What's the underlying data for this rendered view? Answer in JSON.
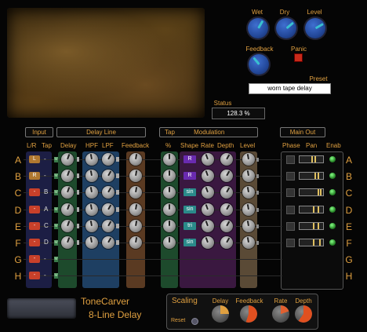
{
  "controls": {
    "wet_label": "Wet",
    "dry_label": "Dry",
    "level_label": "Level",
    "feedback_label": "Feedback",
    "panic_label": "Panic",
    "preset_label": "Preset",
    "preset_value": "worn tape delay",
    "status_label": "Status",
    "status_value": "128.3 %"
  },
  "sections": {
    "input": "Input",
    "delay_line": "Delay Line",
    "tap": "Tap",
    "modulation": "Modulation",
    "main_out": "Main Out"
  },
  "columns": {
    "lr": "L/R",
    "tap": "Tap",
    "delay": "Delay",
    "hpf": "HPF",
    "lpf": "LPF",
    "feedback": "Feedback",
    "pct": "%",
    "shape": "Shape",
    "rate": "Rate",
    "depth": "Depth",
    "level": "Level",
    "phase": "Phase",
    "pan": "Pan",
    "enab": "Enab"
  },
  "rows": [
    {
      "label": "A",
      "lr": "L",
      "tap": "-",
      "shape": "R",
      "mini": "M"
    },
    {
      "label": "B",
      "lr": "R",
      "tap": "-",
      "shape": "R",
      "mini": "M"
    },
    {
      "label": "C",
      "lr": "-",
      "tap": "B",
      "shape": "sin",
      "mini": "M"
    },
    {
      "label": "D",
      "lr": "-",
      "tap": "A",
      "shape": "sin",
      "mini": "M"
    },
    {
      "label": "E",
      "lr": "-",
      "tap": "C",
      "shape": "tri",
      "mini": "M"
    },
    {
      "label": "F",
      "lr": "-",
      "tap": "D",
      "shape": "sin",
      "mini": "M"
    },
    {
      "label": "G",
      "lr": "-",
      "tap": "-",
      "shape": "",
      "mini": "M"
    },
    {
      "label": "H",
      "lr": "-",
      "tap": "-",
      "shape": "",
      "mini": "M"
    }
  ],
  "brand": {
    "name": "ToneCarver",
    "product": "8-Line Delay"
  },
  "scaling": {
    "title": "Scaling",
    "reset": "Reset",
    "delay": "Delay",
    "feedback": "Feedback",
    "rate": "Rate",
    "depth": "Depth"
  },
  "colors": {
    "accent": "#e0a040",
    "green_strip": "#1d4a2c",
    "blue_strip": "#1e3f62",
    "orange_strip": "#5a3a22",
    "purple_strip": "#3a1840",
    "shape_r": "#6a2bb0",
    "shape_sin": "#2a8a8a"
  }
}
